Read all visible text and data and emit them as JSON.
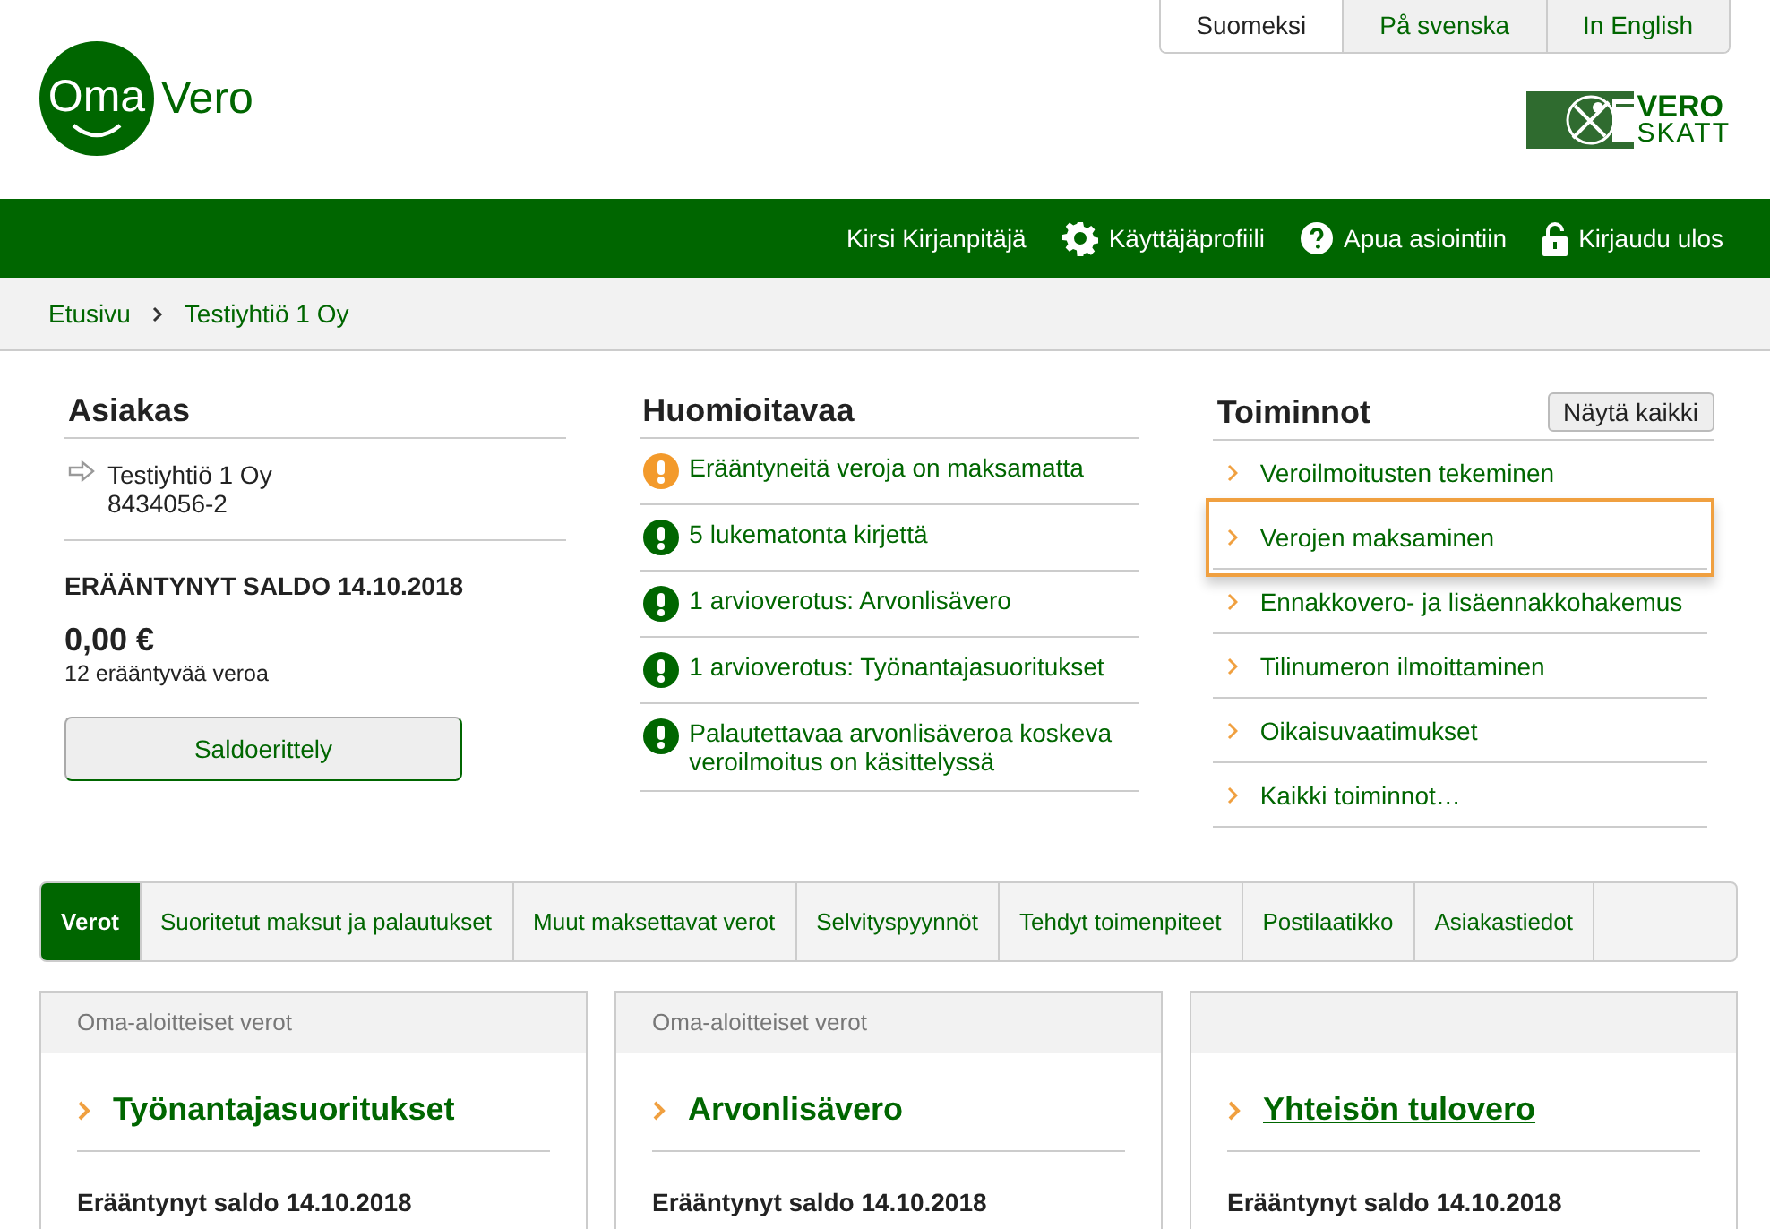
{
  "languages": [
    {
      "label": "Suomeksi",
      "selected": true
    },
    {
      "label": "På svenska",
      "selected": false
    },
    {
      "label": "In English",
      "selected": false
    }
  ],
  "logo": {
    "badge": "Oma",
    "word": "Vero"
  },
  "agency_logo": {
    "top": "VERO",
    "bottom": "SKATT"
  },
  "nav": [
    {
      "kind": "user",
      "label": "Kirsi Kirjanpitäjä"
    },
    {
      "kind": "profile",
      "label": "Käyttäjäprofiili"
    },
    {
      "kind": "help",
      "label": "Apua asiointiin"
    },
    {
      "kind": "logout",
      "label": "Kirjaudu ulos"
    }
  ],
  "breadcrumb": [
    "Etusivu",
    "Testiyhtiö 1 Oy"
  ],
  "customer": {
    "title": "Asiakas",
    "name": "Testiyhtiö 1 Oy",
    "id": "8434056-2",
    "balance_title": "ERÄÄNTYNYT SALDO 14.10.2018",
    "balance": "0,00 €",
    "due_count": "12 erääntyvää veroa",
    "button": "Saldoerittely"
  },
  "notices": {
    "title": "Huomioitavaa",
    "items": [
      {
        "kind": "warning",
        "text": "Erääntyneitä veroja on maksamatta"
      },
      {
        "kind": "info",
        "text": "5 lukematonta kirjettä"
      },
      {
        "kind": "info",
        "text": "1 arvioverotus: Arvonlisävero"
      },
      {
        "kind": "info",
        "text": "1 arvioverotus: Työnantajasuoritukset"
      },
      {
        "kind": "info",
        "text": "Palautettavaa arvonlisäveroa koskeva veroilmoitus on käsittelyssä"
      }
    ]
  },
  "actions": {
    "title": "Toiminnot",
    "show_all": "Näytä kaikki",
    "items": [
      {
        "label": "Veroilmoitusten tekeminen",
        "highlighted": false
      },
      {
        "label": "Verojen maksaminen",
        "highlighted": true
      },
      {
        "label": "Ennakkovero- ja lisäennakkohakemus",
        "highlighted": false
      },
      {
        "label": "Tilinumeron ilmoittaminen",
        "highlighted": false
      },
      {
        "label": "Oikaisuvaatimukset",
        "highlighted": false
      },
      {
        "label": "Kaikki toiminnot…",
        "highlighted": false
      }
    ]
  },
  "tabs": [
    {
      "label": "Verot",
      "selected": true
    },
    {
      "label": "Suoritetut maksut ja palautukset",
      "selected": false
    },
    {
      "label": "Muut maksettavat verot",
      "selected": false
    },
    {
      "label": "Selvityspyynnöt",
      "selected": false
    },
    {
      "label": "Tehdyt toimenpiteet",
      "selected": false
    },
    {
      "label": "Postilaatikko",
      "selected": false
    },
    {
      "label": "Asiakastiedot",
      "selected": false
    }
  ],
  "cards": [
    {
      "header": "Oma-aloitteiset verot",
      "title": "Työnantajasuoritukset",
      "underlined": false,
      "balance": "Erääntynyt saldo 14.10.2018"
    },
    {
      "header": "Oma-aloitteiset verot",
      "title": "Arvonlisävero",
      "underlined": false,
      "balance": "Erääntynyt saldo 14.10.2018"
    },
    {
      "title": "Yhteisön tulovero",
      "underlined": true,
      "balance": "Erääntynyt saldo 14.10.2018"
    }
  ]
}
